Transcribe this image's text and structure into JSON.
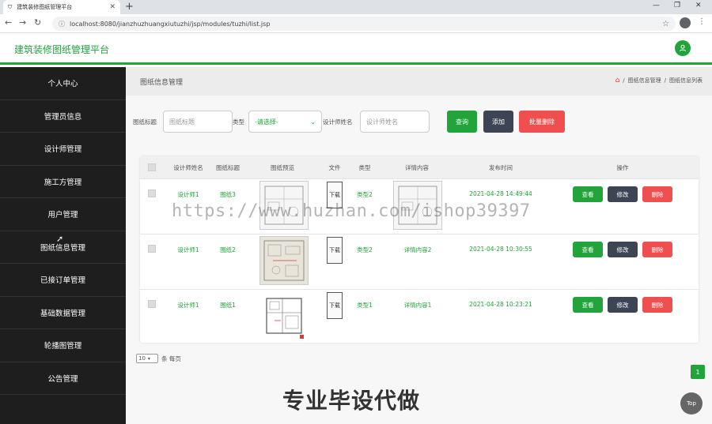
{
  "browser": {
    "tab_title": "建筑装修图纸管理平台",
    "tab_close": "✕",
    "new_tab": "+",
    "url": "localhost:8080/jianzhuzhuangxiutuzhi/jsp/modules/tuzhi/list.jsp",
    "minimize": "—",
    "maximize": "❐",
    "close": "✕"
  },
  "header": {
    "app_title": "建筑装修图纸管理平台"
  },
  "sidebar": {
    "items": [
      {
        "label": "个人中心"
      },
      {
        "label": "管理员信息"
      },
      {
        "label": "设计师管理"
      },
      {
        "label": "施工方管理"
      },
      {
        "label": "用户管理"
      },
      {
        "label": "图纸信息管理"
      },
      {
        "label": "已接订单管理"
      },
      {
        "label": "基础数据管理"
      },
      {
        "label": "轮播图管理"
      },
      {
        "label": "公告管理"
      }
    ]
  },
  "breadcrumb": {
    "page_title": "图纸信息管理",
    "path": [
      "图纸信息管理",
      "图纸信息列表"
    ],
    "separator": "/"
  },
  "search": {
    "title_label": "图纸标题",
    "title_placeholder": "图纸标题",
    "type_label": "类型",
    "type_value": "-请选择-",
    "designer_label": "设计师姓名",
    "designer_placeholder": "设计师姓名",
    "query_button": "查询",
    "add_button": "添加",
    "batch_delete_button": "批量删除"
  },
  "table": {
    "headers": [
      "设计师姓名",
      "图纸标题",
      "图纸预览",
      "文件",
      "类型",
      "详情内容",
      "发布时间",
      "操作"
    ],
    "rows": [
      {
        "designer": "设计师1",
        "title": "图纸3",
        "file": "下载",
        "type": "类型2",
        "detail": "",
        "time": "2021-04-28 14:49:44"
      },
      {
        "designer": "设计师1",
        "title": "图纸2",
        "file": "下载",
        "type": "类型2",
        "detail": "详情内容2",
        "time": "2021-04-28 10:30:55"
      },
      {
        "designer": "设计师1",
        "title": "图纸1",
        "file": "下载",
        "type": "类型1",
        "detail": "详情内容1",
        "time": "2021-04-28 10:23:21"
      }
    ],
    "actions": {
      "view": "查看",
      "edit": "修改",
      "delete": "删除"
    }
  },
  "pagination": {
    "page_size": "10",
    "per_page_label": "条 每页",
    "current_page": "1"
  },
  "overlay": {
    "watermark": "https://www.huzhan.com/ishop39397",
    "promo": "专业毕设代做",
    "top_button": "Top"
  },
  "colors": {
    "accent": "#22a33b",
    "sidebar_bg": "#1e1e1e",
    "dark_button": "#3d4454",
    "danger": "#f04f4f"
  }
}
